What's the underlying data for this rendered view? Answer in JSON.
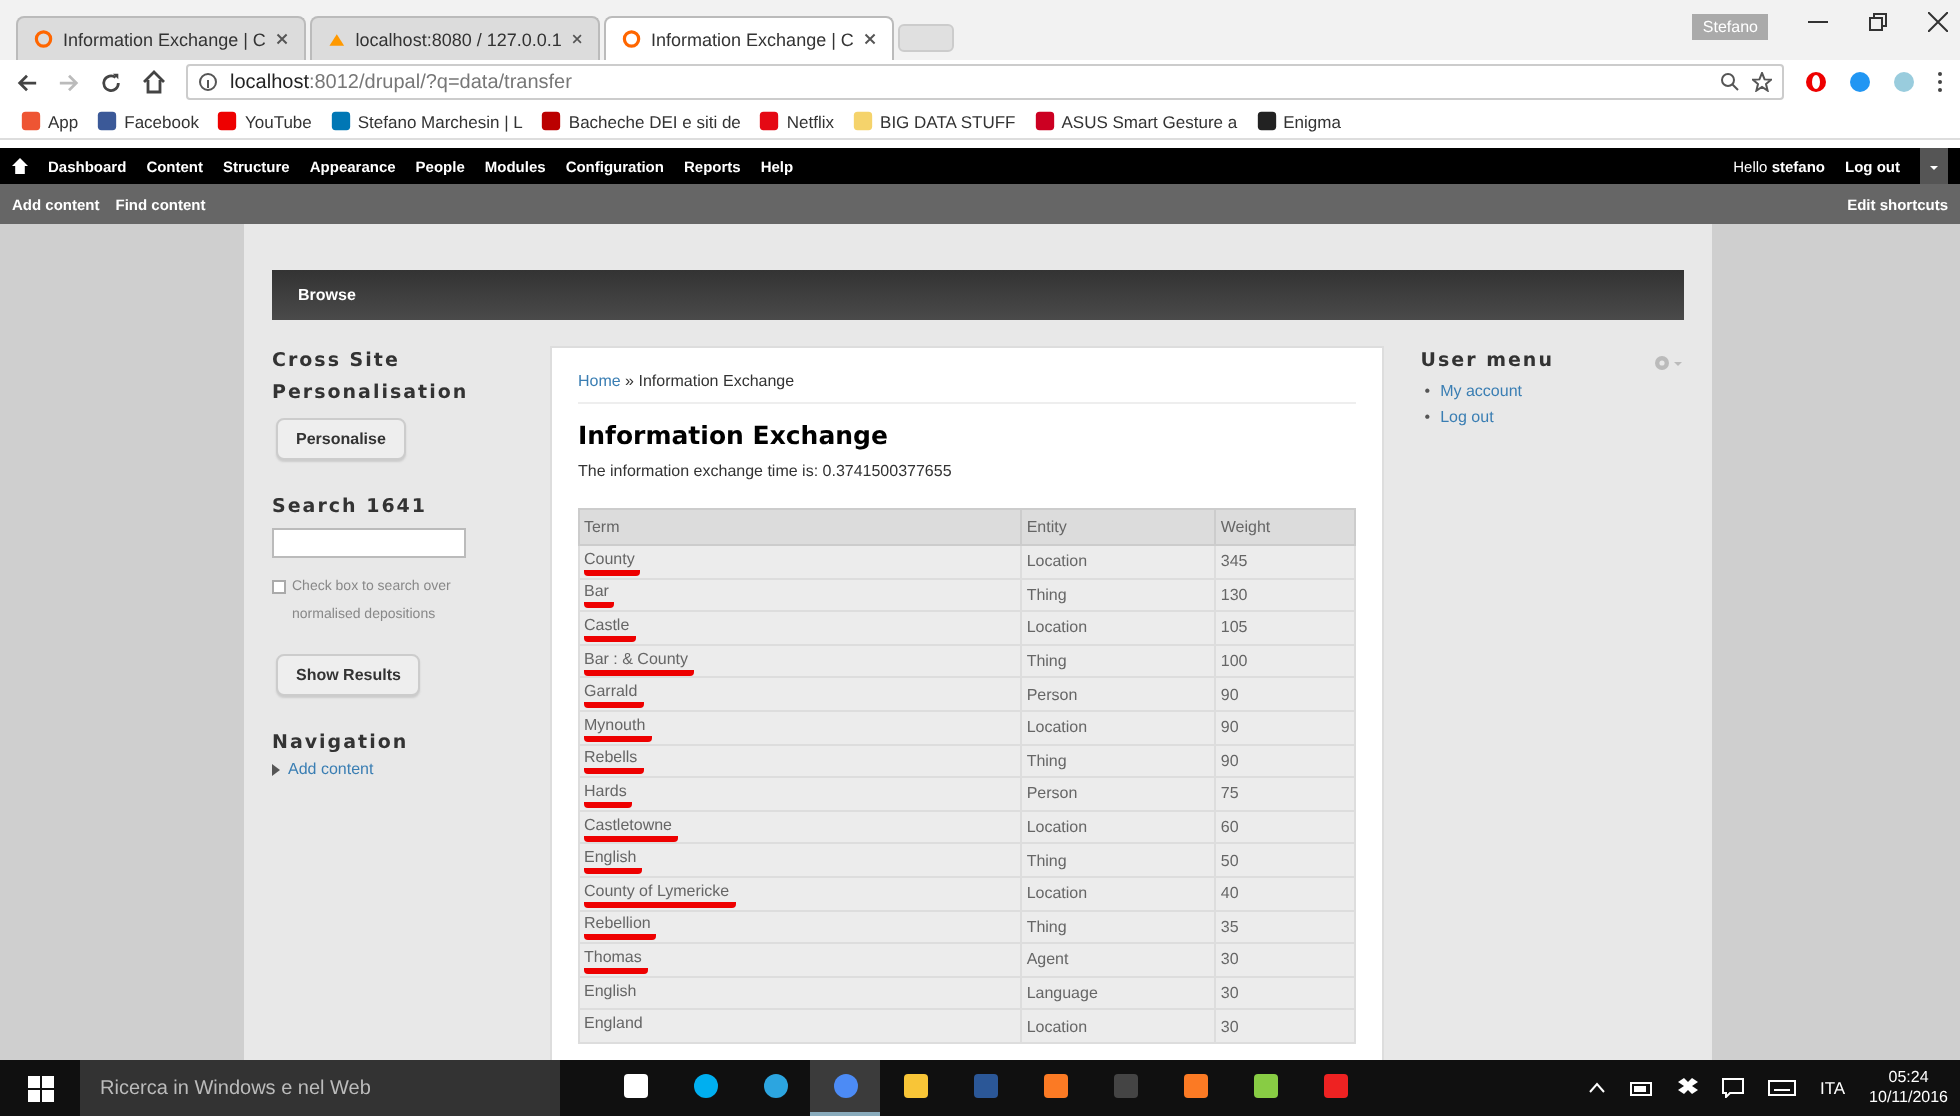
{
  "browser": {
    "tabs": [
      {
        "title": "Information Exchange | C",
        "selected": false
      },
      {
        "title": "localhost:8080 / 127.0.0.1",
        "selected": false
      },
      {
        "title": "Information Exchange | C",
        "selected": true
      }
    ],
    "profile": "Stefano",
    "url_host": "localhost",
    "url_rest": ":8012/drupal/?q=data/transfer",
    "bookmarks": [
      "App",
      "Facebook",
      "YouTube",
      "Stefano Marchesin | L",
      "Bacheche DEI e siti de",
      "Netflix",
      "BIG DATA STUFF",
      "ASUS Smart Gesture a",
      "Enigma"
    ]
  },
  "admin_toolbar": {
    "menu": [
      "Dashboard",
      "Content",
      "Structure",
      "Appearance",
      "People",
      "Modules",
      "Configuration",
      "Reports",
      "Help"
    ],
    "hello": "Hello ",
    "user": "stefano",
    "logout": "Log out",
    "shortcuts": [
      "Add content",
      "Find content"
    ],
    "edit_shortcuts": "Edit shortcuts"
  },
  "nav_bar": {
    "items": [
      "Browse"
    ]
  },
  "left_sidebar": {
    "personalisation_title": "Cross Site Personalisation",
    "personalise_button": "Personalise",
    "search_title": "Search 1641",
    "checkbox_label": "Check box to search over normalised depositions",
    "checkbox_checked": false,
    "show_results": "Show Results",
    "navigation_title": "Navigation",
    "navigation_items": [
      "Add content"
    ]
  },
  "main": {
    "breadcrumb_home": "Home",
    "breadcrumb_sep": " » ",
    "breadcrumb_current": "Information Exchange",
    "title": "Information Exchange",
    "time_text": "The information exchange time is: 0.3741500377655",
    "table": {
      "columns": [
        "Term",
        "Entity",
        "Weight"
      ],
      "rows": [
        {
          "term": "County",
          "entity": "Location",
          "weight": "345",
          "underlined": true
        },
        {
          "term": "Bar",
          "entity": "Thing",
          "weight": "130",
          "underlined": true
        },
        {
          "term": "Castle",
          "entity": "Location",
          "weight": "105",
          "underlined": true
        },
        {
          "term": "Bar : & County",
          "entity": "Thing",
          "weight": "100",
          "underlined": true
        },
        {
          "term": "Garrald",
          "entity": "Person",
          "weight": "90",
          "underlined": true
        },
        {
          "term": "Mynouth",
          "entity": "Location",
          "weight": "90",
          "underlined": true
        },
        {
          "term": "Rebells",
          "entity": "Thing",
          "weight": "90",
          "underlined": true
        },
        {
          "term": "Hards",
          "entity": "Person",
          "weight": "75",
          "underlined": true
        },
        {
          "term": "Castletowne",
          "entity": "Location",
          "weight": "60",
          "underlined": true
        },
        {
          "term": "English",
          "entity": "Thing",
          "weight": "50",
          "underlined": true
        },
        {
          "term": "County of Lymericke",
          "entity": "Location",
          "weight": "40",
          "underlined": true
        },
        {
          "term": "Rebellion",
          "entity": "Thing",
          "weight": "35",
          "underlined": true
        },
        {
          "term": "Thomas",
          "entity": "Agent",
          "weight": "30",
          "underlined": true
        },
        {
          "term": "English",
          "entity": "Language",
          "weight": "30",
          "underlined": false
        },
        {
          "term": "England",
          "entity": "Location",
          "weight": "30",
          "underlined": false
        }
      ]
    }
  },
  "right_sidebar": {
    "title": "User menu",
    "items": [
      {
        "marker": "•",
        "label": "My account"
      },
      {
        "marker": "•",
        "label": "Log out"
      }
    ]
  },
  "taskbar": {
    "search": "Ricerca in Windows e nel Web",
    "apps": [
      {
        "selected": false
      },
      {
        "selected": false
      },
      {
        "selected": false
      },
      {
        "selected": true
      },
      {
        "selected": false
      },
      {
        "selected": false
      },
      {
        "selected": false
      },
      {
        "selected": false
      },
      {
        "selected": false
      },
      {
        "selected": false
      },
      {
        "selected": false
      }
    ],
    "lang": "ITA",
    "time": "05:24",
    "date": "10/11/2016"
  }
}
